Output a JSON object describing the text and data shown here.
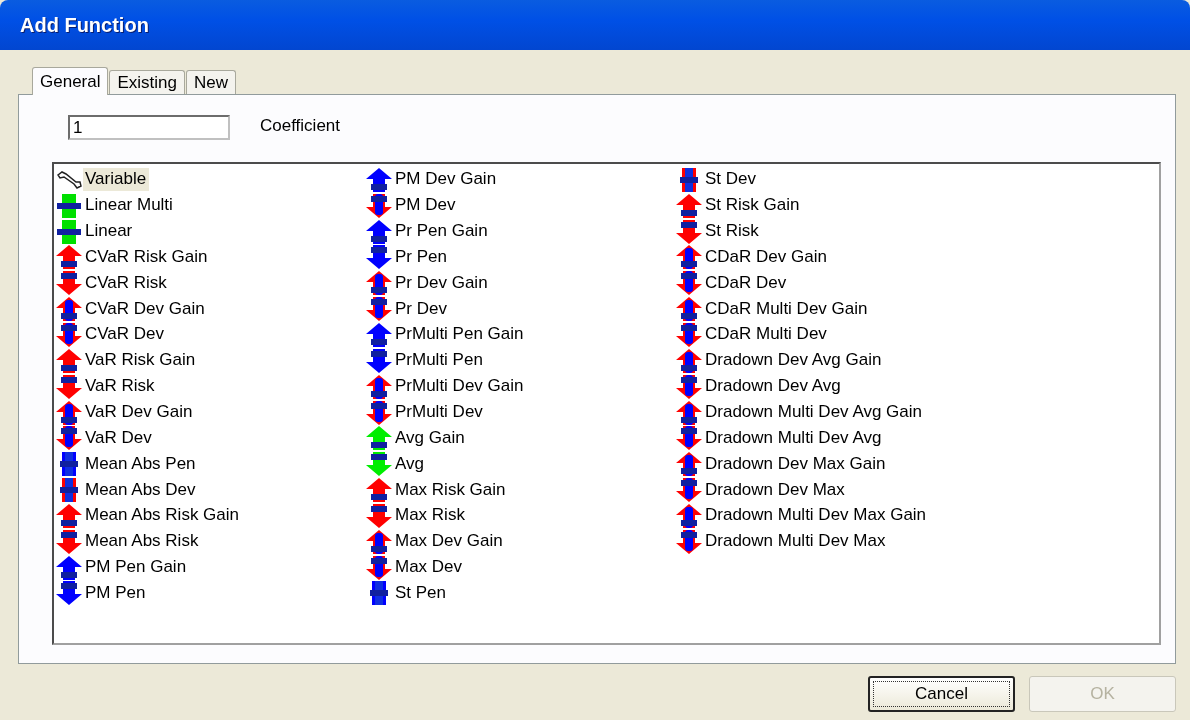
{
  "window": {
    "title": "Add Function"
  },
  "tabs": [
    {
      "label": "General",
      "selected": true
    },
    {
      "label": "Existing",
      "selected": false
    },
    {
      "label": "New",
      "selected": false
    }
  ],
  "coefficient": {
    "value": "1",
    "label": "Coefficient"
  },
  "functions": [
    {
      "label": "Variable",
      "kind": "tool",
      "selected": true
    },
    {
      "label": "Linear Multi",
      "kind": "line",
      "color": "#00e000",
      "selected": false
    },
    {
      "label": "Linear",
      "kind": "line",
      "color": "#00e000",
      "selected": false
    },
    {
      "label": "CVaR Risk Gain",
      "kind": "up",
      "color": "#ff0000",
      "selected": false
    },
    {
      "label": "CVaR Risk",
      "kind": "down",
      "color": "#ff0000",
      "selected": false
    },
    {
      "label": "CVaR Dev Gain",
      "kind": "up-core",
      "color": "#ff0000",
      "selected": false
    },
    {
      "label": "CVaR Dev",
      "kind": "down-core",
      "color": "#ff0000",
      "selected": false
    },
    {
      "label": "VaR Risk Gain",
      "kind": "up",
      "color": "#ff0000",
      "selected": false
    },
    {
      "label": "VaR Risk",
      "kind": "down",
      "color": "#ff0000",
      "selected": false
    },
    {
      "label": "VaR Dev Gain",
      "kind": "up-core",
      "color": "#ff0000",
      "selected": false
    },
    {
      "label": "VaR Dev",
      "kind": "down-core",
      "color": "#ff0000",
      "selected": false
    },
    {
      "label": "Mean Abs Pen",
      "kind": "bar",
      "color": "#0000ff",
      "selected": false
    },
    {
      "label": "Mean Abs Dev",
      "kind": "bar",
      "color": "#ff0000",
      "selected": false
    },
    {
      "label": "Mean Abs Risk Gain",
      "kind": "up",
      "color": "#ff0000",
      "selected": false
    },
    {
      "label": "Mean Abs Risk",
      "kind": "down",
      "color": "#ff0000",
      "selected": false
    },
    {
      "label": "PM Pen Gain",
      "kind": "up",
      "color": "#0000ff",
      "selected": false
    },
    {
      "label": "PM Pen",
      "kind": "down",
      "color": "#0000ff",
      "selected": false
    },
    {
      "label": "PM Dev Gain",
      "kind": "up",
      "color": "#0000ff",
      "selected": false
    },
    {
      "label": "PM Dev",
      "kind": "down-core",
      "color": "#ff0000",
      "selected": false
    },
    {
      "label": "Pr Pen Gain",
      "kind": "up",
      "color": "#0000ff",
      "selected": false
    },
    {
      "label": "Pr Pen",
      "kind": "down",
      "color": "#0000ff",
      "selected": false
    },
    {
      "label": "Pr Dev Gain",
      "kind": "up-core",
      "color": "#ff0000",
      "selected": false
    },
    {
      "label": "Pr Dev",
      "kind": "down-core",
      "color": "#ff0000",
      "selected": false
    },
    {
      "label": "PrMulti Pen Gain",
      "kind": "up",
      "color": "#0000ff",
      "selected": false
    },
    {
      "label": "PrMulti Pen",
      "kind": "down",
      "color": "#0000ff",
      "selected": false
    },
    {
      "label": "PrMulti Dev Gain",
      "kind": "up-core",
      "color": "#ff0000",
      "selected": false
    },
    {
      "label": "PrMulti Dev",
      "kind": "down-core",
      "color": "#ff0000",
      "selected": false
    },
    {
      "label": "Avg Gain",
      "kind": "up",
      "color": "#00ee00",
      "selected": false
    },
    {
      "label": "Avg",
      "kind": "down",
      "color": "#00ee00",
      "selected": false
    },
    {
      "label": "Max Risk Gain",
      "kind": "up",
      "color": "#ff0000",
      "selected": false
    },
    {
      "label": "Max Risk",
      "kind": "down",
      "color": "#ff0000",
      "selected": false
    },
    {
      "label": "Max Dev Gain",
      "kind": "up-core",
      "color": "#ff0000",
      "selected": false
    },
    {
      "label": "Max Dev",
      "kind": "down-core",
      "color": "#ff0000",
      "selected": false
    },
    {
      "label": "St Pen",
      "kind": "bar",
      "color": "#0000ff",
      "selected": false
    },
    {
      "label": "St Dev",
      "kind": "bar",
      "color": "#ff0000",
      "selected": false
    },
    {
      "label": "St Risk Gain",
      "kind": "up",
      "color": "#ff0000",
      "selected": false
    },
    {
      "label": "St Risk",
      "kind": "down",
      "color": "#ff0000",
      "selected": false
    },
    {
      "label": "CDaR Dev Gain",
      "kind": "up-core",
      "color": "#ff0000",
      "selected": false
    },
    {
      "label": "CDaR Dev",
      "kind": "down-core",
      "color": "#ff0000",
      "selected": false
    },
    {
      "label": "CDaR Multi Dev Gain",
      "kind": "up-core",
      "color": "#ff0000",
      "selected": false
    },
    {
      "label": "CDaR Multi Dev",
      "kind": "down-core",
      "color": "#ff0000",
      "selected": false
    },
    {
      "label": "Dradown Dev Avg Gain",
      "kind": "up-core",
      "color": "#ff0000",
      "selected": false
    },
    {
      "label": "Dradown Dev Avg",
      "kind": "down-core",
      "color": "#ff0000",
      "selected": false
    },
    {
      "label": "Dradown Multi Dev Avg Gain",
      "kind": "up-core",
      "color": "#ff0000",
      "selected": false
    },
    {
      "label": "Dradown Multi Dev Avg",
      "kind": "down-core",
      "color": "#ff0000",
      "selected": false
    },
    {
      "label": "Dradown Dev Max Gain",
      "kind": "up-core",
      "color": "#ff0000",
      "selected": false
    },
    {
      "label": "Dradown Dev Max",
      "kind": "down-core",
      "color": "#ff0000",
      "selected": false
    },
    {
      "label": "Dradown Multi Dev Max Gain",
      "kind": "up-core",
      "color": "#ff0000",
      "selected": false
    },
    {
      "label": "Dradown Multi Dev Max",
      "kind": "down-core",
      "color": "#ff0000",
      "selected": false
    }
  ],
  "buttons": [
    {
      "label": "Cancel",
      "disabled": false,
      "focused": true
    },
    {
      "label": "OK",
      "disabled": true,
      "focused": false
    }
  ]
}
